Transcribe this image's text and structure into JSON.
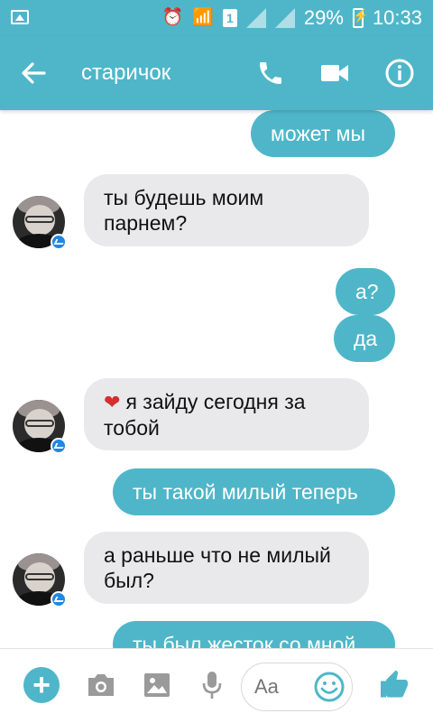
{
  "status_bar": {
    "battery": "29%",
    "time": "10:33",
    "sim": "1"
  },
  "header": {
    "title": "старичок"
  },
  "messages": [
    {
      "side": "out",
      "text": "может мы"
    },
    {
      "side": "in",
      "text": "ты будешь моим парнем?"
    },
    {
      "side": "out",
      "text": "а?"
    },
    {
      "side": "out",
      "text": "да"
    },
    {
      "side": "in",
      "text": "я зайду сегодня за тобой",
      "prefix_icon": "heart"
    },
    {
      "side": "out",
      "text": "ты такой милый теперь"
    },
    {
      "side": "in",
      "text": "а раньше что не милый был?"
    },
    {
      "side": "out",
      "text": "ты был жесток со мной"
    }
  ],
  "composer": {
    "placeholder": "Aa"
  },
  "colors": {
    "accent": "#4fb6c9",
    "incoming_bubble": "#e9e9eb"
  }
}
